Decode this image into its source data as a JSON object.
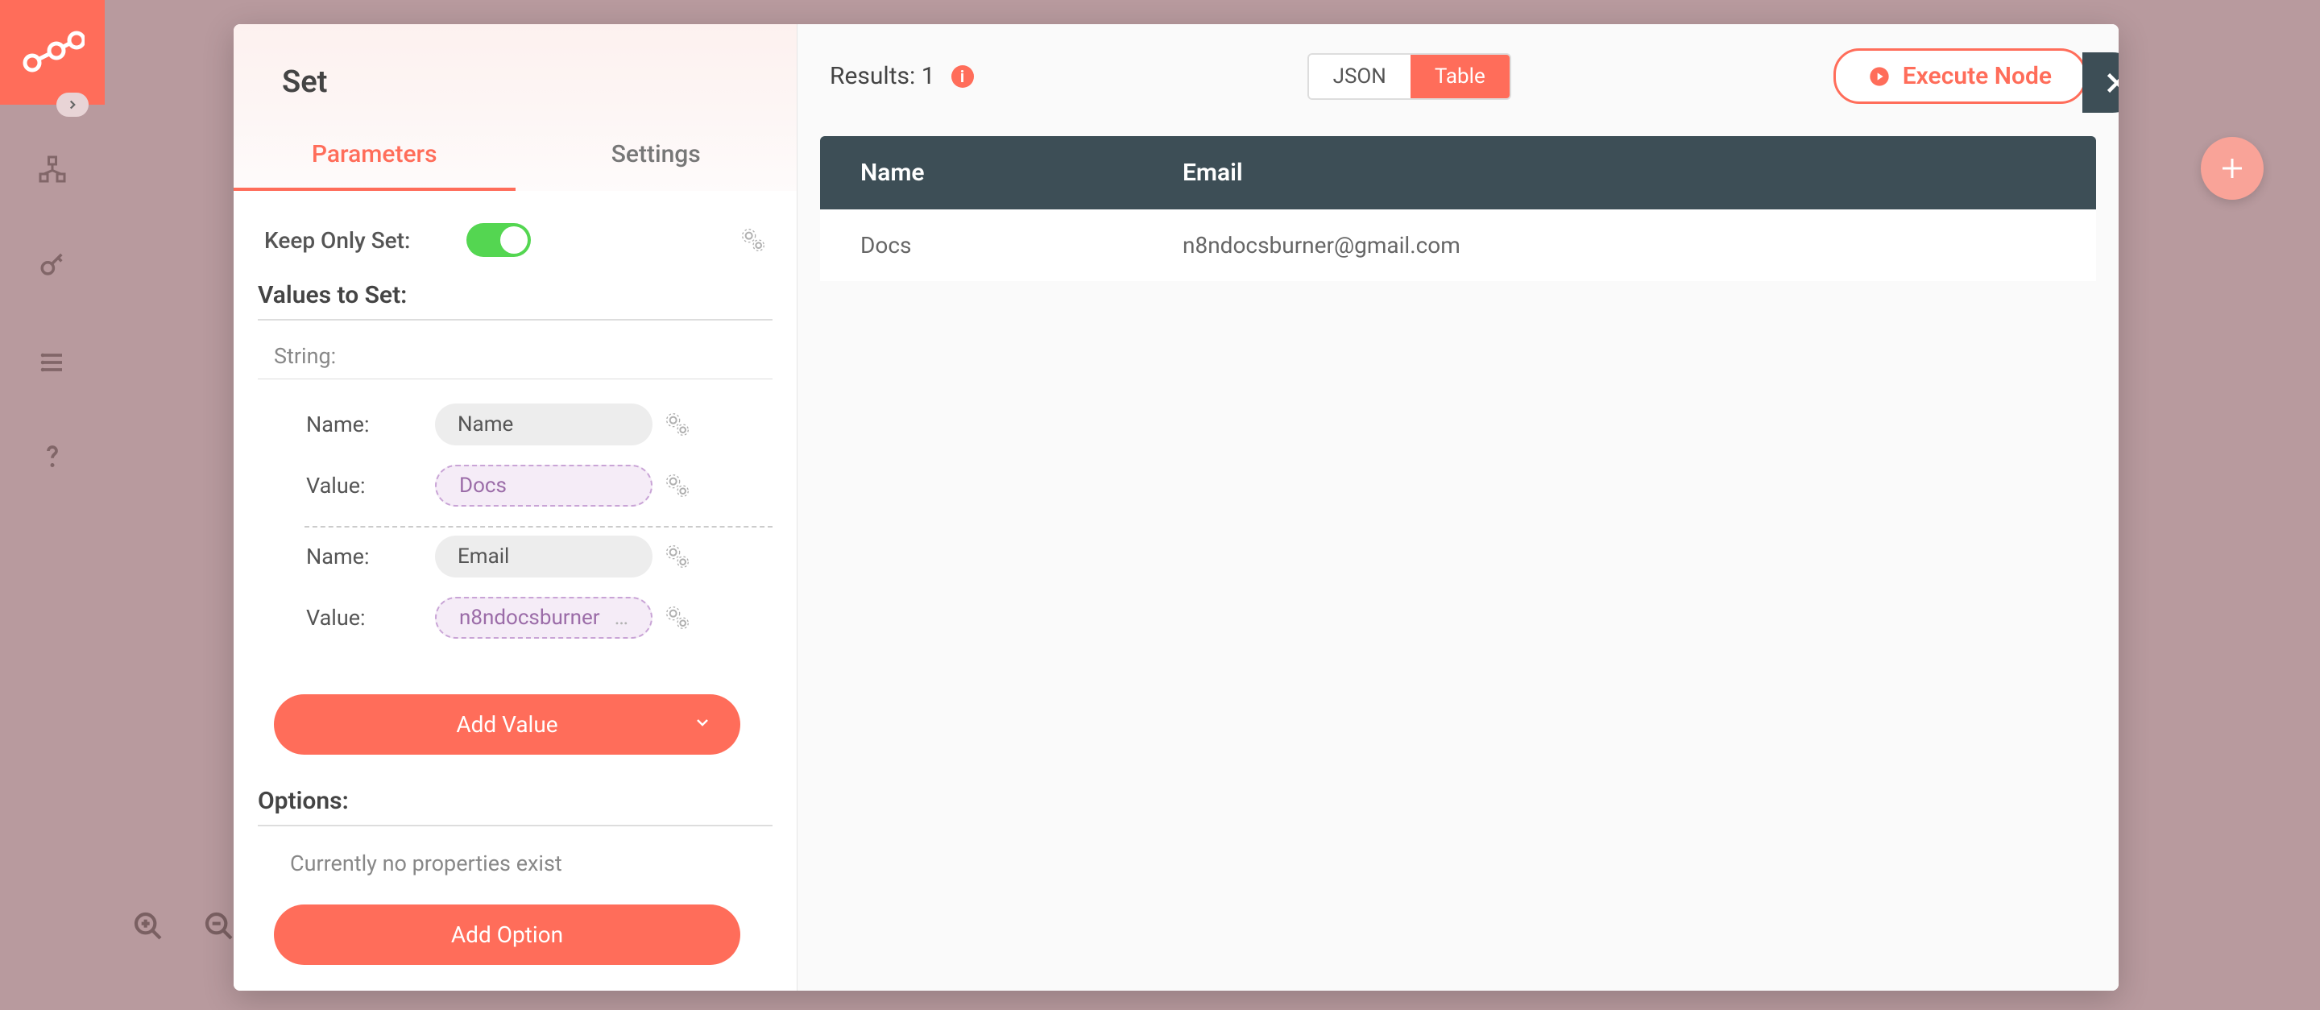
{
  "node": {
    "title": "Set"
  },
  "tabs": {
    "parameters": "Parameters",
    "settings": "Settings"
  },
  "params": {
    "keepOnlySetLabel": "Keep Only Set:",
    "valuesToSetLabel": "Values to Set:",
    "stringLabel": "String:",
    "fields": [
      {
        "nameLabel": "Name:",
        "nameValue": "Name",
        "valueLabel": "Value:",
        "valueValue": "Docs"
      },
      {
        "nameLabel": "Name:",
        "nameValue": "Email",
        "valueLabel": "Value:",
        "valueValue": "n8ndocsburner"
      }
    ],
    "addValueLabel": "Add Value",
    "optionsLabel": "Options:",
    "noPropsText": "Currently no properties exist",
    "addOptionLabel": "Add Option"
  },
  "results": {
    "label": "Results: 1",
    "viewJson": "JSON",
    "viewTable": "Table",
    "executeLabel": "Execute Node",
    "columns": {
      "name": "Name",
      "email": "Email"
    },
    "rows": [
      {
        "name": "Docs",
        "email": "n8ndocsburner@gmail.com"
      }
    ]
  }
}
